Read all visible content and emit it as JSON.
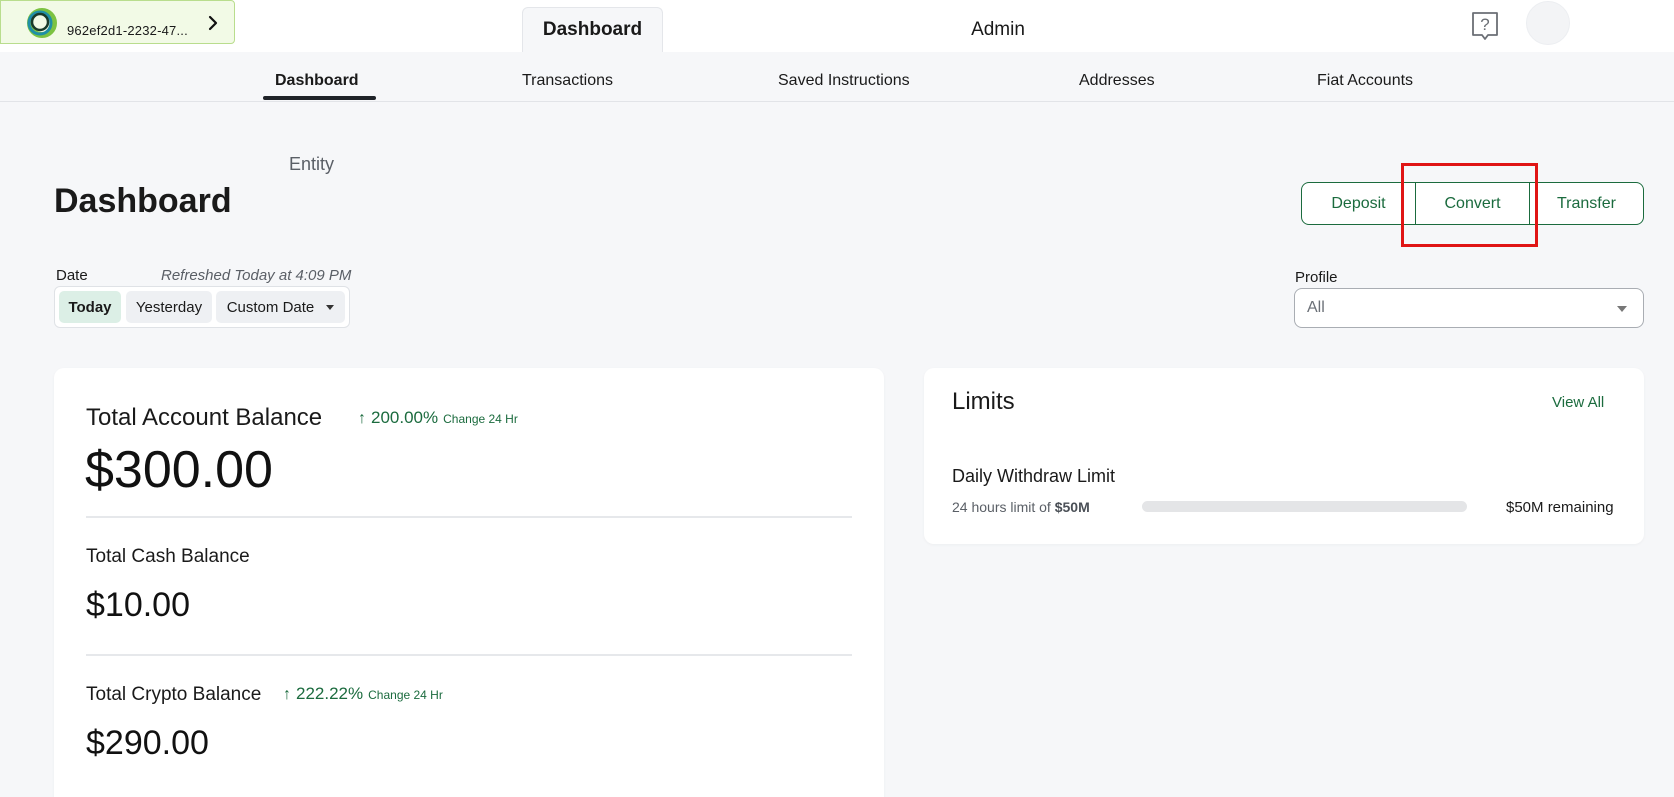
{
  "entity_switcher": {
    "id_text": "962ef2d1-2232-47..."
  },
  "top_tabs": {
    "dashboard": "Dashboard",
    "admin": "Admin"
  },
  "subnav": {
    "items": [
      "Dashboard",
      "Transactions",
      "Saved Instructions",
      "Addresses",
      "Fiat Accounts"
    ],
    "active_index": 0
  },
  "header": {
    "entity_label": "Entity",
    "title": "Dashboard"
  },
  "actions": {
    "deposit": "Deposit",
    "convert": "Convert",
    "transfer": "Transfer"
  },
  "date_filter": {
    "label": "Date",
    "refreshed": "Refreshed Today at 4:09 PM",
    "options": [
      "Today",
      "Yesterday",
      "Custom Date"
    ],
    "selected": "Today"
  },
  "profile": {
    "label": "Profile",
    "value": "All"
  },
  "balances": {
    "total_account": {
      "label": "Total Account Balance",
      "change_pct": "200.00%",
      "change_label": "Change 24 Hr",
      "value": "$300.00"
    },
    "total_cash": {
      "label": "Total Cash Balance",
      "value": "$10.00"
    },
    "total_crypto": {
      "label": "Total Crypto Balance",
      "change_pct": "222.22%",
      "change_label": "Change 24 Hr",
      "value": "$290.00"
    }
  },
  "limits": {
    "title": "Limits",
    "view_all": "View All",
    "daily_withdraw": {
      "name": "Daily Withdraw Limit",
      "sub_prefix": "24 hours limit of",
      "sub_amount": "$50M",
      "remaining": "$50M remaining",
      "used_fraction": 0
    }
  },
  "colors": {
    "brand_green": "#1b6b3e",
    "highlight_red": "#e01515",
    "background": "#f6f7f9"
  },
  "icons": {
    "entity_logo": "ring-logo-icon",
    "entity_chevron": "chevron-right-icon",
    "help": "help-question-icon",
    "up_arrow": "arrow-up-icon"
  }
}
